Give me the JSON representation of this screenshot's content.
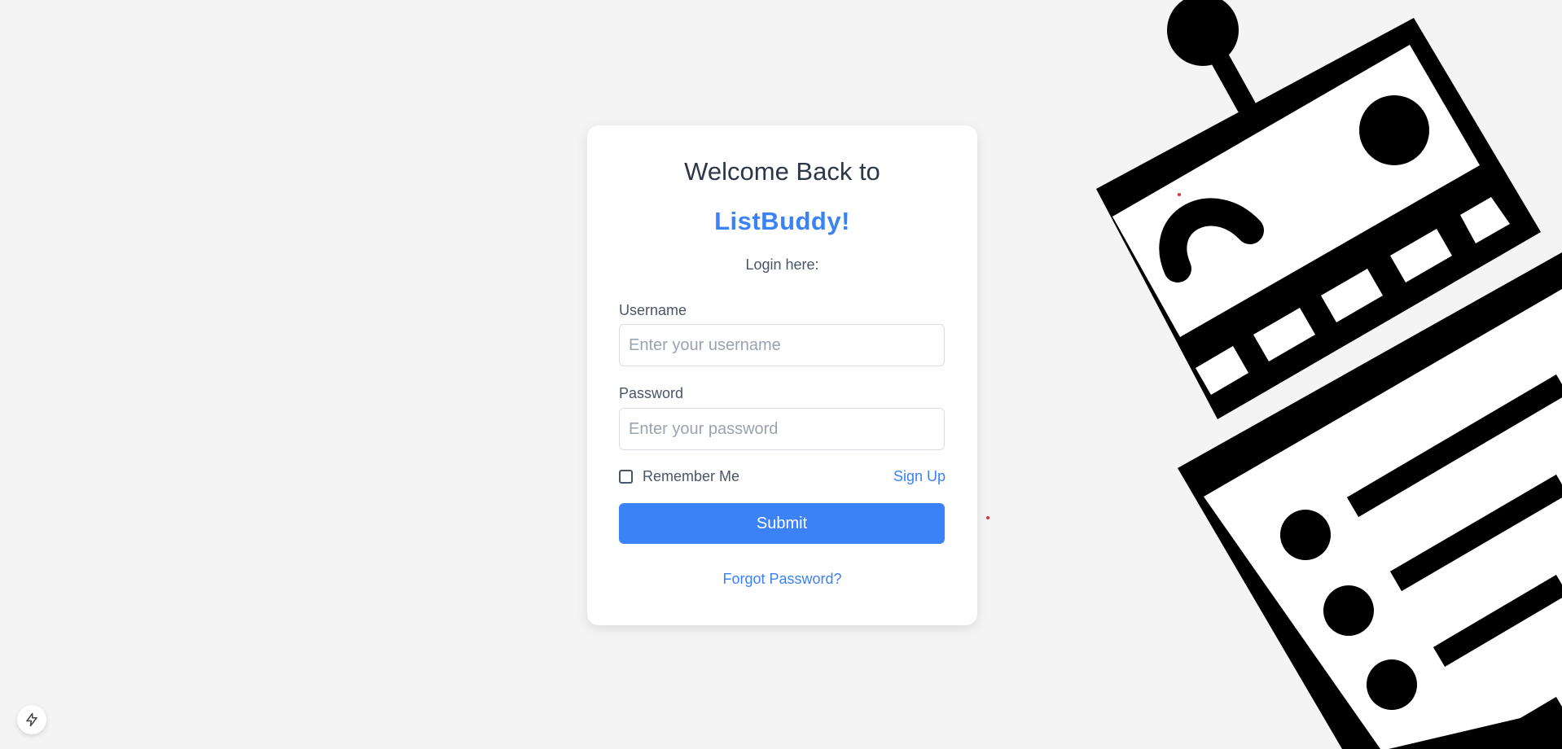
{
  "login": {
    "welcome": "Welcome Back to",
    "brand": "ListBuddy!",
    "subtitle": "Login here:",
    "username_label": "Username",
    "username_placeholder": "Enter your username",
    "password_label": "Password",
    "password_placeholder": "Enter your password",
    "remember_label": "Remember Me",
    "signup_link": "Sign Up",
    "submit_label": "Submit",
    "forgot_link": "Forgot Password?"
  },
  "colors": {
    "accent": "#3b82f6",
    "background": "#f4f4f4"
  },
  "icons": {
    "illustration": "robot-illustration",
    "fab": "lightning-icon"
  }
}
